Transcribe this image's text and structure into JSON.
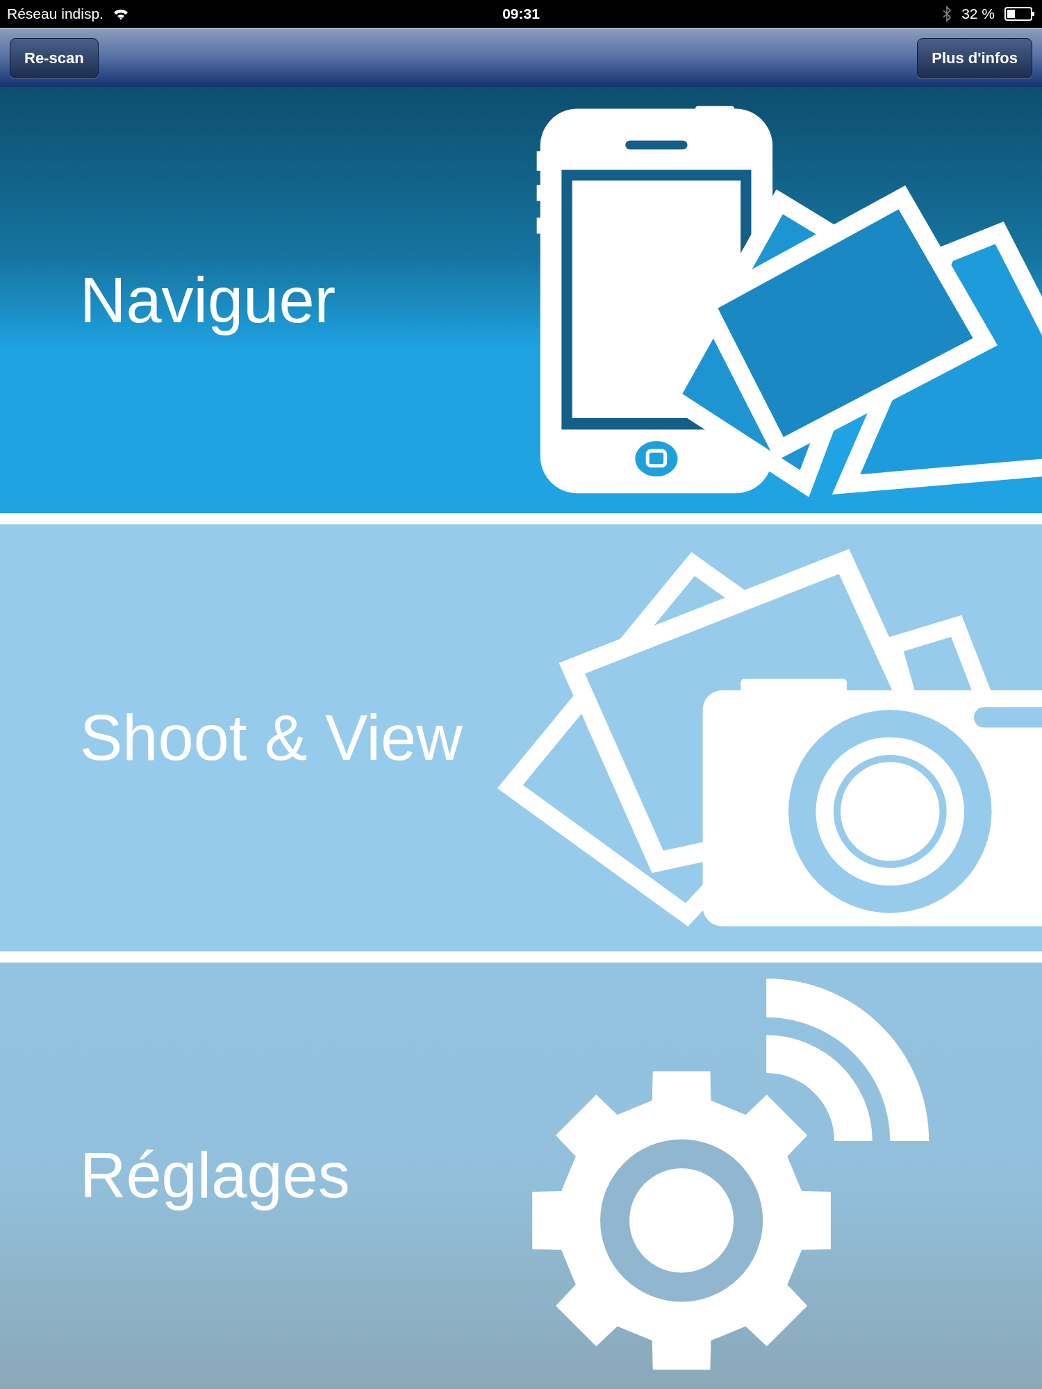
{
  "status_bar": {
    "carrier": "Réseau indisp.",
    "time": "09:31",
    "battery": "32 %"
  },
  "nav_bar": {
    "buttons": [
      "Re-scan",
      "Plus d'infos"
    ]
  },
  "menu": [
    {
      "title": "Naviguer",
      "kind": "browse"
    },
    {
      "title": "Shoot & View",
      "kind": "camera"
    },
    {
      "title": "Réglages",
      "kind": "settings"
    }
  ]
}
